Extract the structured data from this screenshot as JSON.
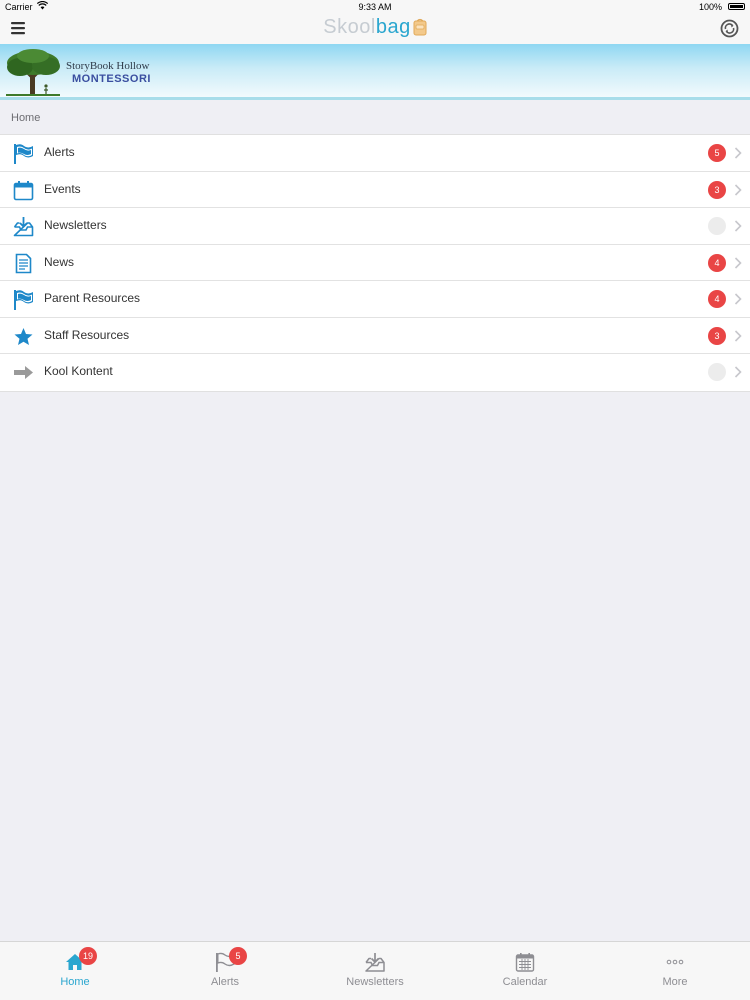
{
  "status_bar": {
    "carrier": "Carrier",
    "time": "9:33 AM",
    "battery": "100%"
  },
  "nav": {
    "logo_part1": "Skool",
    "logo_part2": "bag",
    "menu_icon": "hamburger-menu-icon",
    "sync_icon": "sync-icon"
  },
  "banner": {
    "school_name_line1": "StoryBook Hollow",
    "school_name_line2": "MONTESSORI"
  },
  "section": {
    "title": "Home"
  },
  "menu_items": [
    {
      "label": "Alerts",
      "icon": "flag-icon",
      "badge": "5"
    },
    {
      "label": "Events",
      "icon": "calendar-icon",
      "badge": "3"
    },
    {
      "label": "Newsletters",
      "icon": "inbox-download-icon",
      "badge": ""
    },
    {
      "label": "News",
      "icon": "document-icon",
      "badge": "4"
    },
    {
      "label": "Parent Resources",
      "icon": "flag-icon",
      "badge": "4"
    },
    {
      "label": "Staff Resources",
      "icon": "star-icon",
      "badge": "3"
    },
    {
      "label": "Kool Kontent",
      "icon": "arrow-right-icon",
      "badge": ""
    }
  ],
  "tabs": [
    {
      "label": "Home",
      "icon": "home-icon",
      "badge": "19",
      "active": true
    },
    {
      "label": "Alerts",
      "icon": "flag-icon",
      "badge": "5",
      "active": false
    },
    {
      "label": "Newsletters",
      "icon": "inbox-download-icon",
      "badge": "",
      "active": false
    },
    {
      "label": "Calendar",
      "icon": "calendar-icon",
      "badge": "",
      "active": false
    },
    {
      "label": "More",
      "icon": "more-dots-icon",
      "badge": "",
      "active": false
    }
  ],
  "colors": {
    "accent": "#2aa6cf",
    "badge": "#e94545",
    "background": "#efeff4"
  }
}
